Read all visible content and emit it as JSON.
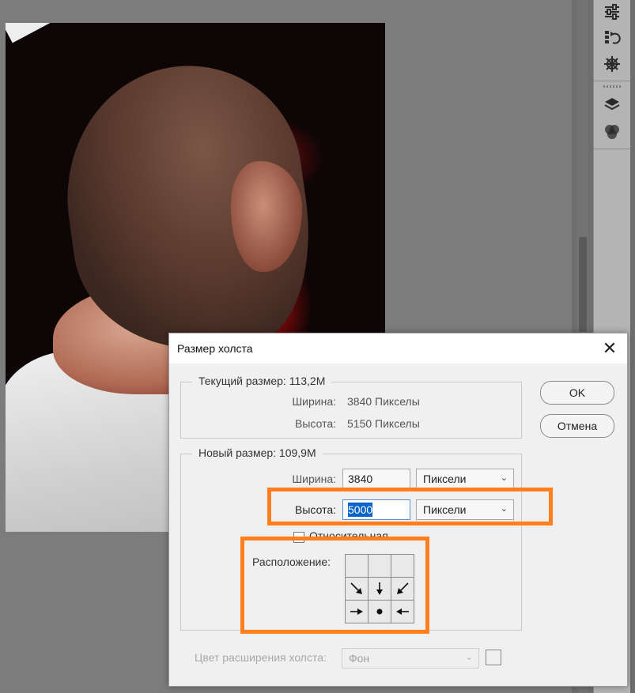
{
  "dialog": {
    "title": "Размер холста",
    "close_icon": "close-icon",
    "current_size": {
      "legend": "Текущий размер: 113,2M",
      "width_label": "Ширина:",
      "width_value": "3840 Пикселы",
      "height_label": "Высота:",
      "height_value": "5150 Пикселы"
    },
    "new_size": {
      "legend": "Новый размер: 109,9M",
      "width_label": "Ширина:",
      "width_value": "3840",
      "width_unit": "Пиксели",
      "height_label": "Высота:",
      "height_value": "5000",
      "height_unit": "Пиксели",
      "relative_label": "Относительная",
      "relative_checked": false,
      "anchor_label": "Расположение:",
      "anchor_cells": [
        "",
        "",
        "",
        "arrow-down-right-icon",
        "arrow-down-icon",
        "arrow-down-left-icon",
        "arrow-right-icon",
        "anchor-dot-icon",
        "arrow-left-icon"
      ]
    },
    "extension_color_label": "Цвет расширения холста:",
    "extension_color_value": "Фон",
    "ok_label": "OK",
    "cancel_label": "Отмена"
  },
  "highlight_color": "#ff7f1e",
  "panel_icons": [
    "adjustments-sliders-icon",
    "history-icon",
    "3d-wheel-icon",
    "layers-icon",
    "channels-icon"
  ]
}
